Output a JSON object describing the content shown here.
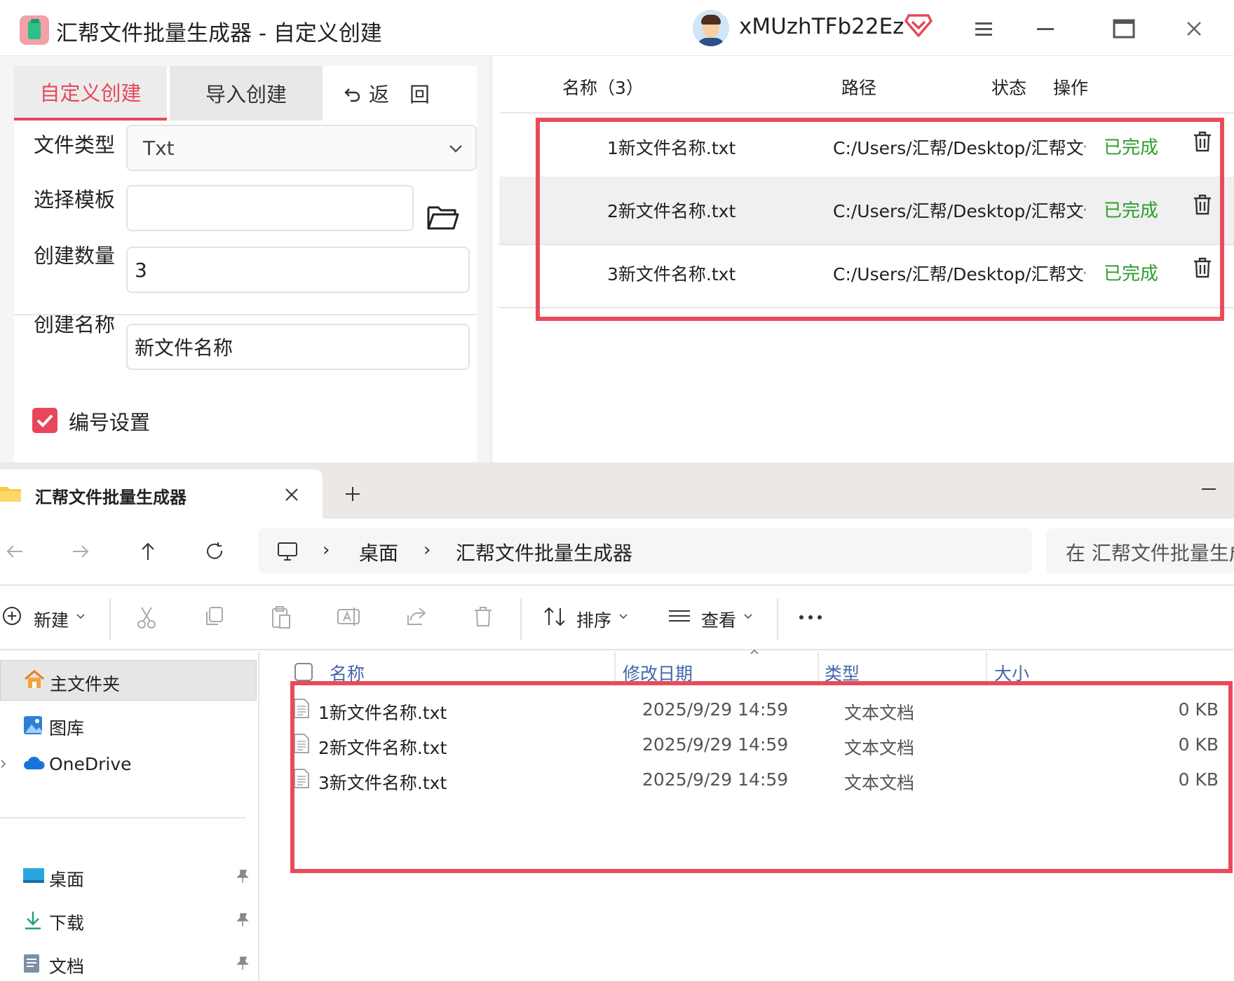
{
  "app": {
    "title": "汇帮文件批量生成器 - 自定义创建",
    "username": "xMUzhTFb22Ez",
    "tabs": {
      "custom": "自定义创建",
      "import": "导入创建",
      "back": "返　回"
    },
    "form": {
      "file_type_label": "文件类型",
      "file_type_value": "Txt",
      "template_label": "选择模板",
      "template_value": "",
      "count_label": "创建数量",
      "count_value": "3",
      "name_label": "创建名称",
      "name_value": "新文件名称",
      "numbering_label": "编号设置",
      "numbering_checked": true
    },
    "list": {
      "headers": {
        "name": "名称（3）",
        "path": "路径",
        "status": "状态",
        "action": "操作"
      },
      "rows": [
        {
          "name": "1新文件名称.txt",
          "path": "C:/Users/汇帮/Desktop/汇帮文件",
          "status": "已完成"
        },
        {
          "name": "2新文件名称.txt",
          "path": "C:/Users/汇帮/Desktop/汇帮文件",
          "status": "已完成"
        },
        {
          "name": "3新文件名称.txt",
          "path": "C:/Users/汇帮/Desktop/汇帮文件",
          "status": "已完成"
        }
      ]
    },
    "colors": {
      "accent": "#e8475b",
      "status_done": "#2e9e2e",
      "highlight": "#ea4b5b"
    }
  },
  "explorer": {
    "tab_title": "汇帮文件批量生成器",
    "breadcrumb": {
      "desktop": "桌面",
      "folder": "汇帮文件批量生成器"
    },
    "search_placeholder": "在 汇帮文件批量生成器 中搜索",
    "toolbar": {
      "new": "新建",
      "sort": "排序",
      "view": "查看"
    },
    "sidebar": {
      "home": "主文件夹",
      "gallery": "图库",
      "onedrive": "OneDrive",
      "desktop": "桌面",
      "downloads": "下载",
      "documents": "文档"
    },
    "columns": {
      "name": "名称",
      "modified": "修改日期",
      "type": "类型",
      "size": "大小"
    },
    "files": [
      {
        "name": "1新文件名称.txt",
        "modified": "2025/9/29 14:59",
        "type": "文本文档",
        "size": "0 KB"
      },
      {
        "name": "2新文件名称.txt",
        "modified": "2025/9/29 14:59",
        "type": "文本文档",
        "size": "0 KB"
      },
      {
        "name": "3新文件名称.txt",
        "modified": "2025/9/29 14:59",
        "type": "文本文档",
        "size": "0 KB"
      }
    ]
  }
}
